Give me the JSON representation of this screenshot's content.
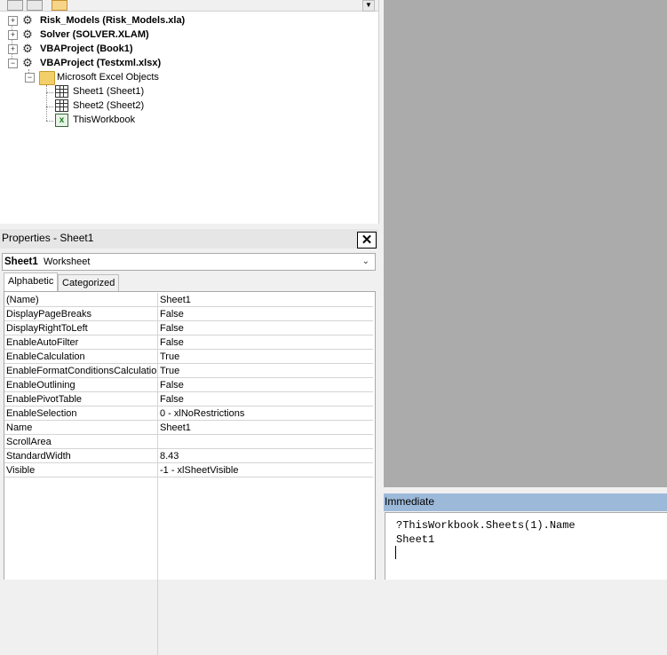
{
  "project": {
    "items": [
      {
        "label": "Risk_Models (Risk_Models.xla)",
        "bold": true
      },
      {
        "label": "Solver (SOLVER.XLAM)",
        "bold": true
      },
      {
        "label": "VBAProject (Book1)",
        "bold": true
      },
      {
        "label": "VBAProject (Testxml.xlsx)",
        "bold": true
      },
      {
        "label": "Microsoft Excel Objects",
        "bold": false
      },
      {
        "label": "Sheet1 (Sheet1)",
        "bold": false
      },
      {
        "label": "Sheet2 (Sheet2)",
        "bold": false
      },
      {
        "label": "ThisWorkbook",
        "bold": false
      }
    ],
    "expander_plus": "+",
    "expander_minus": "−"
  },
  "properties": {
    "title": "Properties - Sheet1",
    "close_glyph": "✕",
    "object_name": "Sheet1",
    "object_type": "Worksheet",
    "tabs": [
      "Alphabetic",
      "Categorized"
    ],
    "rows": [
      {
        "name": "(Name)",
        "value": "Sheet1"
      },
      {
        "name": "DisplayPageBreaks",
        "value": "False"
      },
      {
        "name": "DisplayRightToLeft",
        "value": "False"
      },
      {
        "name": "EnableAutoFilter",
        "value": "False"
      },
      {
        "name": "EnableCalculation",
        "value": "True"
      },
      {
        "name": "EnableFormatConditionsCalculation",
        "value": "True"
      },
      {
        "name": "EnableOutlining",
        "value": "False"
      },
      {
        "name": "EnablePivotTable",
        "value": "False"
      },
      {
        "name": "EnableSelection",
        "value": "0 - xlNoRestrictions"
      },
      {
        "name": "Name",
        "value": "Sheet1"
      },
      {
        "name": "ScrollArea",
        "value": ""
      },
      {
        "name": "StandardWidth",
        "value": "8.43"
      },
      {
        "name": "Visible",
        "value": "-1 - xlSheetVisible"
      }
    ]
  },
  "immediate": {
    "title": "Immediate",
    "lines": [
      "?ThisWorkbook.Sheets(1).Name",
      "Sheet1"
    ]
  },
  "icons": {
    "project": "project-icon",
    "folder": "folder-icon",
    "sheet": "sheet-icon",
    "workbook": "workbook-icon",
    "chevron": "⌄"
  },
  "colors": {
    "code_area_bg": "#ababab",
    "immediate_title_bg": "#9db9d9"
  }
}
